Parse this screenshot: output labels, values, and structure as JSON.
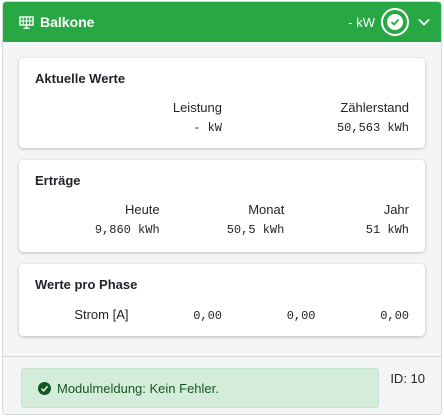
{
  "header": {
    "title": "Balkone",
    "power": "- kW",
    "icon": "solar-panel-icon",
    "accent_color": "#28a745"
  },
  "current": {
    "heading": "Aktuelle Werte",
    "items": [
      {
        "label": "Leistung",
        "value": "- kW"
      },
      {
        "label": "Zählerstand",
        "value": "50,563 kWh"
      }
    ]
  },
  "yields": {
    "heading": "Erträge",
    "items": [
      {
        "label": "Heute",
        "value": "9,860 kWh"
      },
      {
        "label": "Monat",
        "value": "50,5 kWh"
      },
      {
        "label": "Jahr",
        "value": "51 kWh"
      }
    ]
  },
  "phases": {
    "heading": "Werte pro Phase",
    "label": "Strom [A]",
    "values": [
      "0,00",
      "0,00",
      "0,00"
    ]
  },
  "footer": {
    "message": "Modulmeldung: Kein Fehler.",
    "id_text": "ID: 10",
    "status_color": "#d4edda"
  }
}
